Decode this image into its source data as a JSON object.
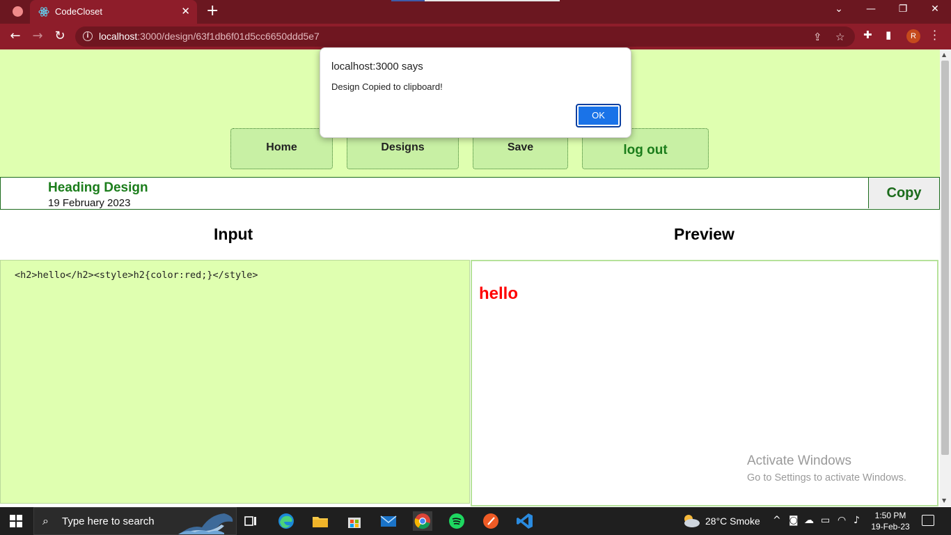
{
  "browser": {
    "tab_title": "CodeCloset",
    "tab_close": "✕",
    "new_tab": "+",
    "url_host": "localhost",
    "url_path": ":3000/design/63f1db6f01d5cc6650ddd5e7",
    "profile_initial": "R",
    "accent_color": "#8e1d2a"
  },
  "nav": {
    "items": [
      {
        "label": "Home"
      },
      {
        "label": "Designs"
      },
      {
        "label": "Save"
      },
      {
        "label": "log out"
      }
    ]
  },
  "design": {
    "title": "Heading Design",
    "date": "19 February 2023",
    "copy_label": "Copy"
  },
  "editor": {
    "input_heading": "Input",
    "preview_heading": "Preview",
    "code": "<h2>hello</h2><style>h2{color:red;}</style>",
    "preview_text": "hello",
    "preview_color": "#ff0000"
  },
  "dialog": {
    "origin": "localhost:3000 says",
    "message": "Design Copied to clipboard!",
    "ok_label": "OK"
  },
  "watermark": {
    "line1": "Activate Windows",
    "line2": "Go to Settings to activate Windows."
  },
  "taskbar": {
    "search_placeholder": "Type here to search",
    "weather": "28°C  Smoke",
    "time": "1:50 PM",
    "date": "19-Feb-23",
    "apps": [
      "task-view-icon",
      "edge-icon",
      "file-explorer-icon",
      "store-icon",
      "mail-icon",
      "chrome-icon",
      "spotify-icon",
      "postman-icon",
      "vscode-icon"
    ]
  }
}
